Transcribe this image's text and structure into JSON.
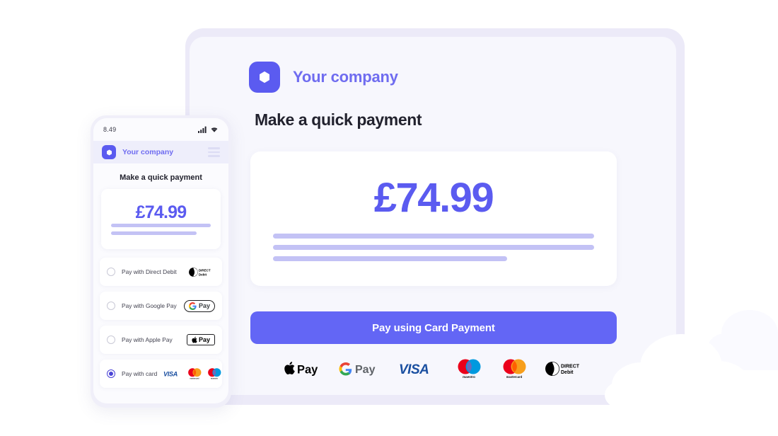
{
  "colors": {
    "accent": "#5b5bf0",
    "button": "#6366f5",
    "brand_text": "#6f6cf0",
    "skeleton": "#c3c2f5",
    "frame": "#eceaf8",
    "card_bg": "#f7f7fd",
    "page_bg": "#ffffff",
    "title_text": "#22222e"
  },
  "desktop": {
    "brand": {
      "logo_icon": "hexagon-logo-icon",
      "name": "Your company"
    },
    "page_title": "Make a quick payment",
    "amount_card": {
      "amount": "£74.99",
      "skeleton_lines": [
        "100",
        "100",
        "73"
      ]
    },
    "pay_button": {
      "label": "Pay using Card Payment"
    },
    "accepted_logos": [
      {
        "name": "apple-pay-logo",
        "label": "Apple Pay"
      },
      {
        "name": "google-pay-logo",
        "label": "G Pay"
      },
      {
        "name": "visa-logo",
        "label": "VISA"
      },
      {
        "name": "maestro-logo",
        "label": "maestro"
      },
      {
        "name": "mastercard-logo",
        "label": "mastercard"
      },
      {
        "name": "direct-debit-logo",
        "label": "DIRECT Debit"
      }
    ]
  },
  "phone": {
    "status_bar": {
      "time": "8.49",
      "signal_icon": "cellular-signal-icon",
      "wifi_icon": "wifi-icon"
    },
    "header": {
      "logo_icon": "hexagon-logo-icon",
      "brand": "Your company",
      "menu_icon": "hamburger-menu-icon"
    },
    "page_title": "Make a quick payment",
    "amount_card": {
      "amount": "£74.99",
      "skeleton_lines": [
        "100",
        "86"
      ]
    },
    "payment_options": [
      {
        "id": "direct-debit",
        "label": "Pay with Direct Debit",
        "selected": false,
        "marks": [
          "direct-debit-logo"
        ]
      },
      {
        "id": "google-pay",
        "label": "Pay with Google Pay",
        "selected": false,
        "marks": [
          "google-pay-logo"
        ]
      },
      {
        "id": "apple-pay",
        "label": "Pay with Apple Pay",
        "selected": false,
        "marks": [
          "apple-pay-logo"
        ]
      },
      {
        "id": "card",
        "label": "Pay with card",
        "selected": true,
        "marks": [
          "visa-logo",
          "mastercard-logo",
          "maestro-logo"
        ]
      }
    ]
  },
  "decor": {
    "clouds": [
      "cloud-bottom-left",
      "cloud-bottom-right",
      "cloud-far-right"
    ]
  }
}
